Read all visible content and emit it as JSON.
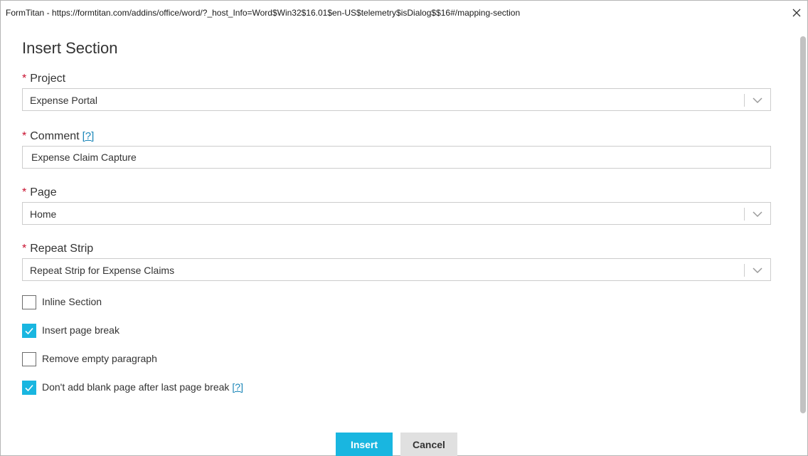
{
  "window": {
    "title": "FormTitan - https://formtitan.com/addins/office/word/?_host_Info=Word$Win32$16.01$en-US$telemetry$isDialog$$16#/mapping-section",
    "close_icon": "close-icon"
  },
  "page": {
    "heading": "Insert Section"
  },
  "fields": {
    "required_marker": "*",
    "project": {
      "label": "Project",
      "value": "Expense Portal"
    },
    "comment": {
      "label": "Comment",
      "help": "[?]",
      "value": "Expense Claim Capture"
    },
    "page": {
      "label": "Page",
      "value": "Home"
    },
    "repeat_strip": {
      "label": "Repeat Strip",
      "value": "Repeat Strip for Expense Claims"
    }
  },
  "options": [
    {
      "label": "Inline Section",
      "checked": false
    },
    {
      "label": "Insert page break",
      "checked": true
    },
    {
      "label": "Remove empty paragraph",
      "checked": false
    },
    {
      "label": "Don't add blank page after last page break",
      "checked": true,
      "help": "[?]"
    }
  ],
  "buttons": {
    "insert": "Insert",
    "cancel": "Cancel"
  },
  "colors": {
    "accent": "#19b6e0",
    "required": "#c8102e",
    "help_link": "#1a86b8"
  }
}
